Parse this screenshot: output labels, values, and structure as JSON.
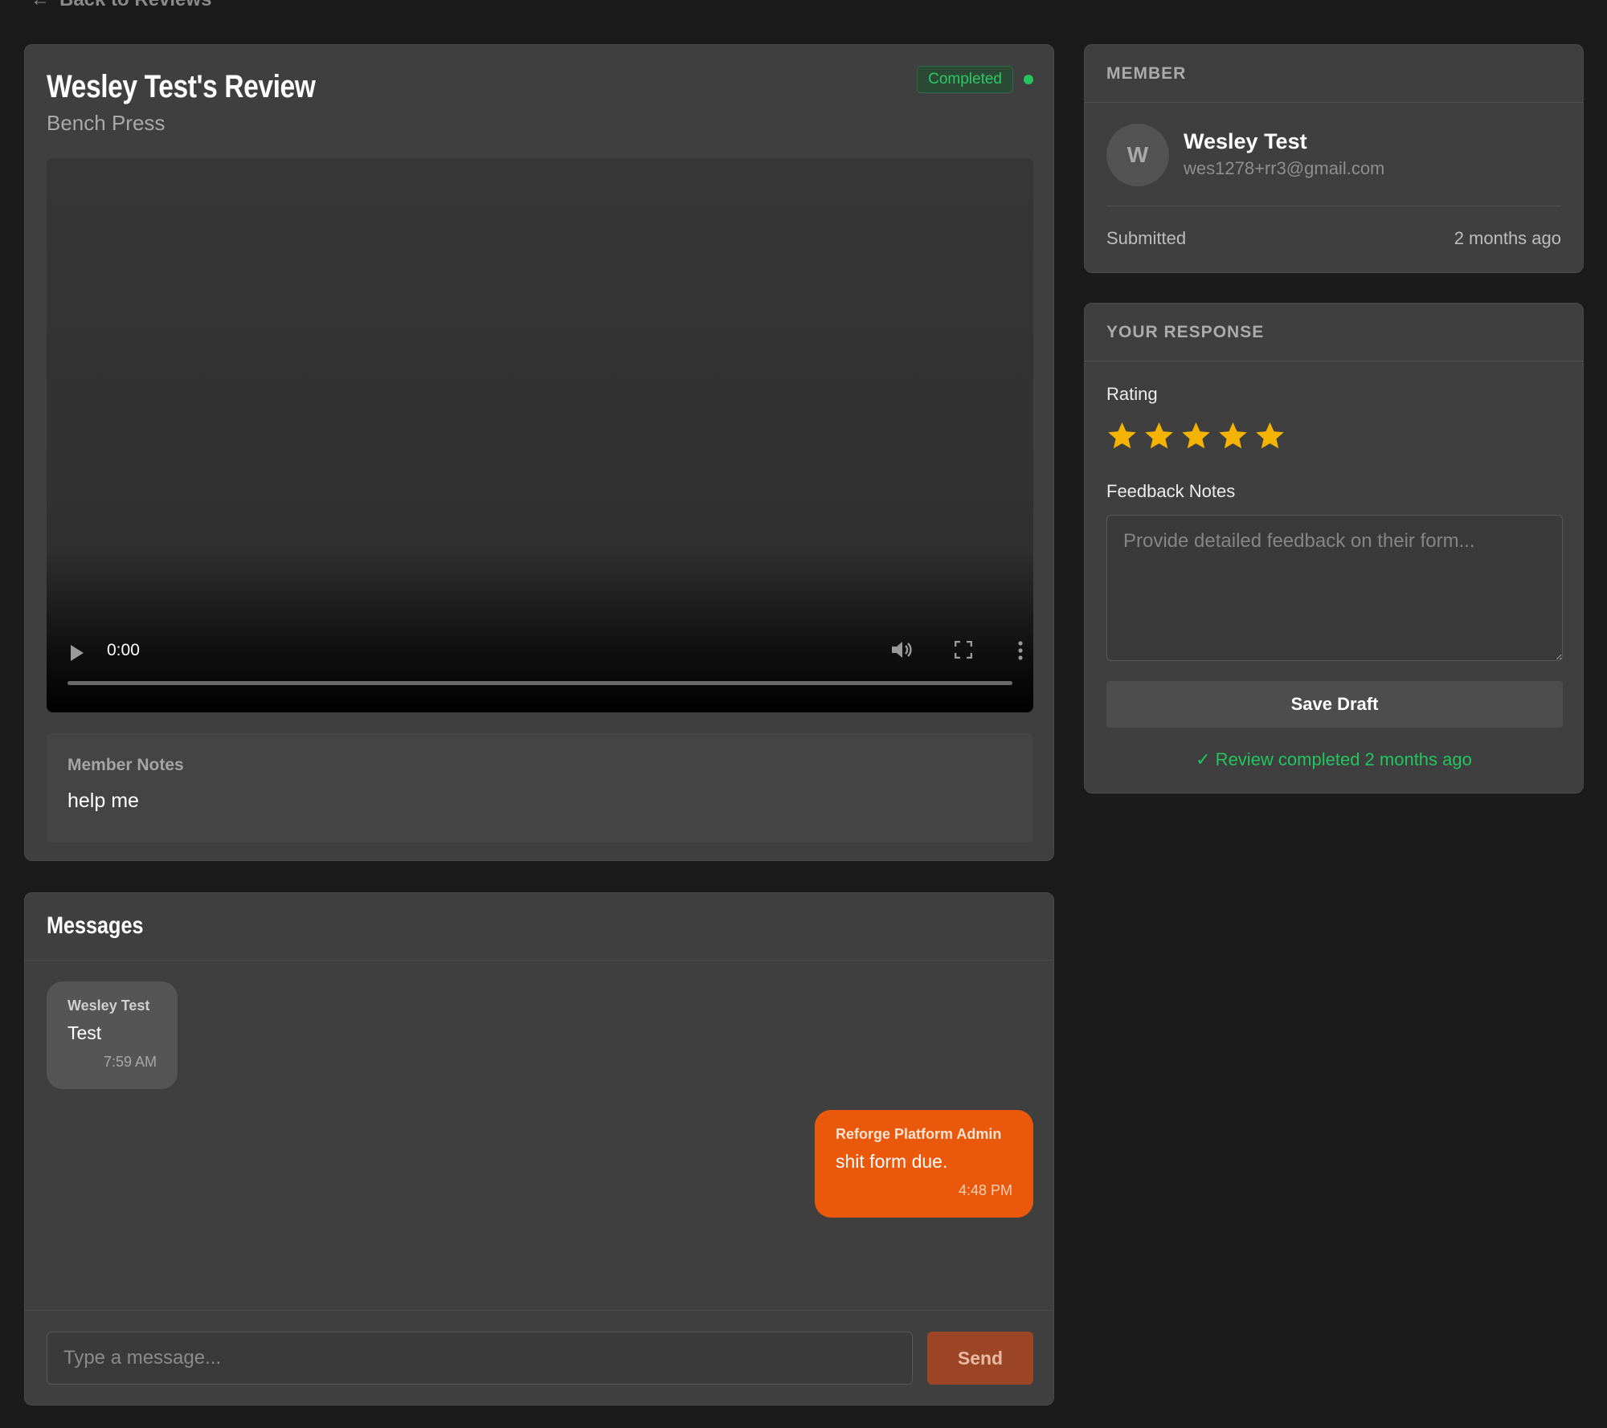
{
  "nav": {
    "back_label": "Back to Reviews"
  },
  "review": {
    "title": "Wesley Test's Review",
    "exercise": "Bench Press",
    "status": "Completed",
    "status_color": "#22c55e",
    "video": {
      "time": "0:00",
      "progress": 0
    },
    "member_notes_label": "Member Notes",
    "member_notes": "help me"
  },
  "messages": {
    "title": "Messages",
    "items": [
      {
        "sender": "Wesley Test",
        "text": "Test",
        "time": "7:59 AM",
        "direction": "incoming"
      },
      {
        "sender": "Reforge Platform Admin",
        "text": "shit form due.",
        "time": "4:48 PM",
        "direction": "outgoing"
      }
    ],
    "input_placeholder": "Type a message...",
    "send_label": "Send"
  },
  "member": {
    "section_title": "MEMBER",
    "avatar_initial": "W",
    "name": "Wesley Test",
    "email": "wes1278+rr3@gmail.com",
    "submitted_label": "Submitted",
    "submitted_value": "2 months ago"
  },
  "response": {
    "section_title": "YOUR RESPONSE",
    "rating_label": "Rating",
    "rating": 5,
    "rating_max": 5,
    "star_color": "#f5b301",
    "feedback_label": "Feedback Notes",
    "feedback_placeholder": "Provide detailed feedback on their form...",
    "save_label": "Save Draft",
    "completed_text": "✓ Review completed 2 months ago"
  },
  "colors": {
    "accent": "#ea580c",
    "background": "#1b1b1b",
    "card": "#3f3f3f",
    "success": "#22c55e"
  }
}
